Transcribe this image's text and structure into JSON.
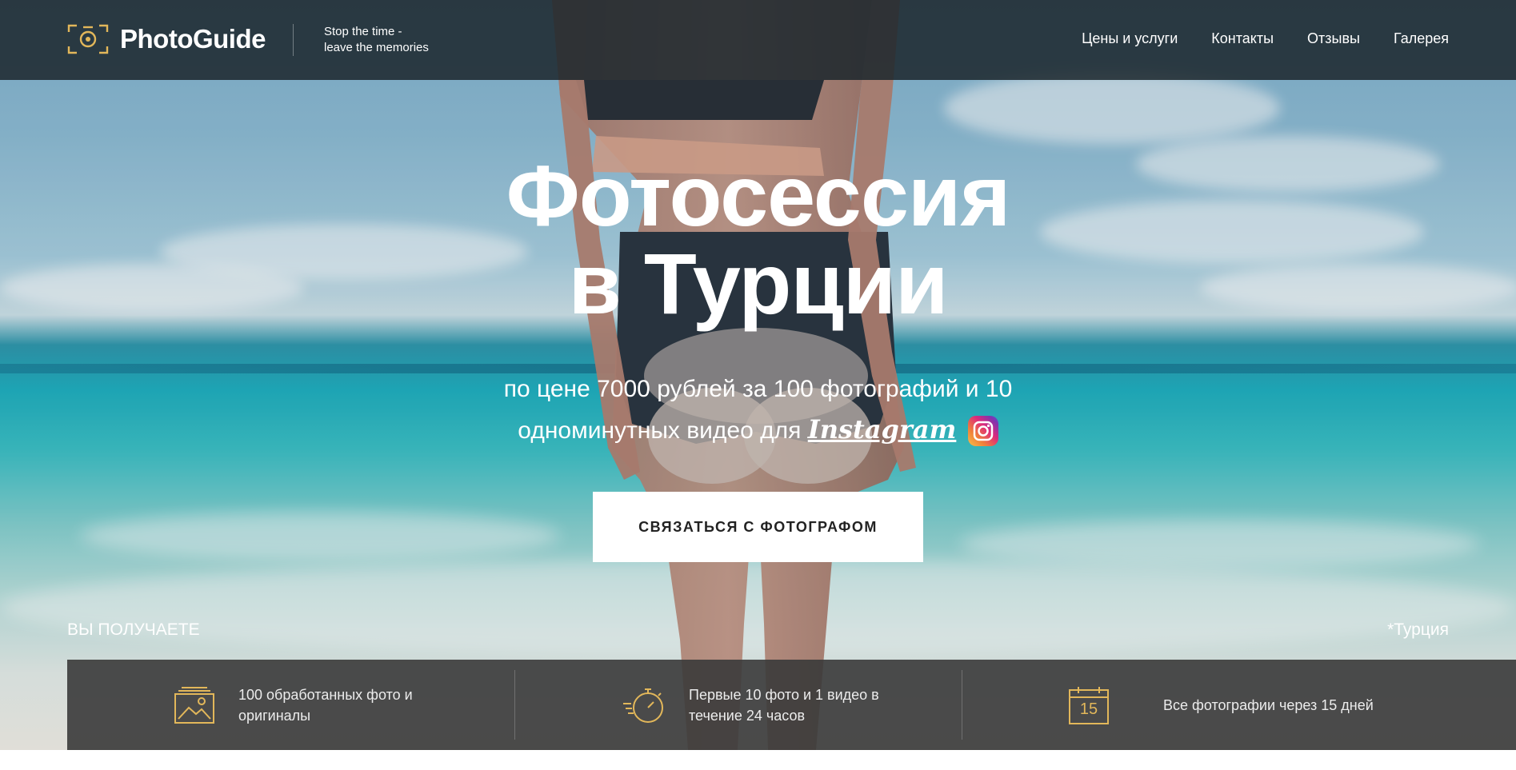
{
  "header": {
    "brand": "PhotoGuide",
    "tagline_line1": "Stop the time -",
    "tagline_line2": "leave the memories",
    "nav": [
      "Цены и услуги",
      "Контакты",
      "Отзывы",
      "Галерея"
    ]
  },
  "hero": {
    "title_line1": "Фотосессия",
    "title_line2": "в Турции",
    "subtitle_line1": "по цене 7000 рублей за 100 фотографий и 10",
    "subtitle_line2": "одноминутных видео для",
    "instagram_label": "Instagram",
    "cta_label": "СВЯЗАТЬСЯ С ФОТОГРАФОМ",
    "you_get_label": "ВЫ ПОЛУЧАЕТЕ",
    "country_note": "*Турция"
  },
  "features": [
    {
      "icon": "photos-icon",
      "line1": "100 обработанных фото и",
      "line2": "оригиналы"
    },
    {
      "icon": "stopwatch-icon",
      "line1": "Первые 10 фото и 1 видео в",
      "line2": "течение 24 часов"
    },
    {
      "icon": "calendar-icon",
      "line1": "Все фотографии через 15 дней",
      "line2": "",
      "calendar_day": "15"
    }
  ],
  "colors": {
    "accent": "#e2b75a",
    "header_bg": "#1c262c",
    "features_bg": "#3a3a3a",
    "cta_bg": "#ffffff",
    "cta_text": "#222222"
  }
}
